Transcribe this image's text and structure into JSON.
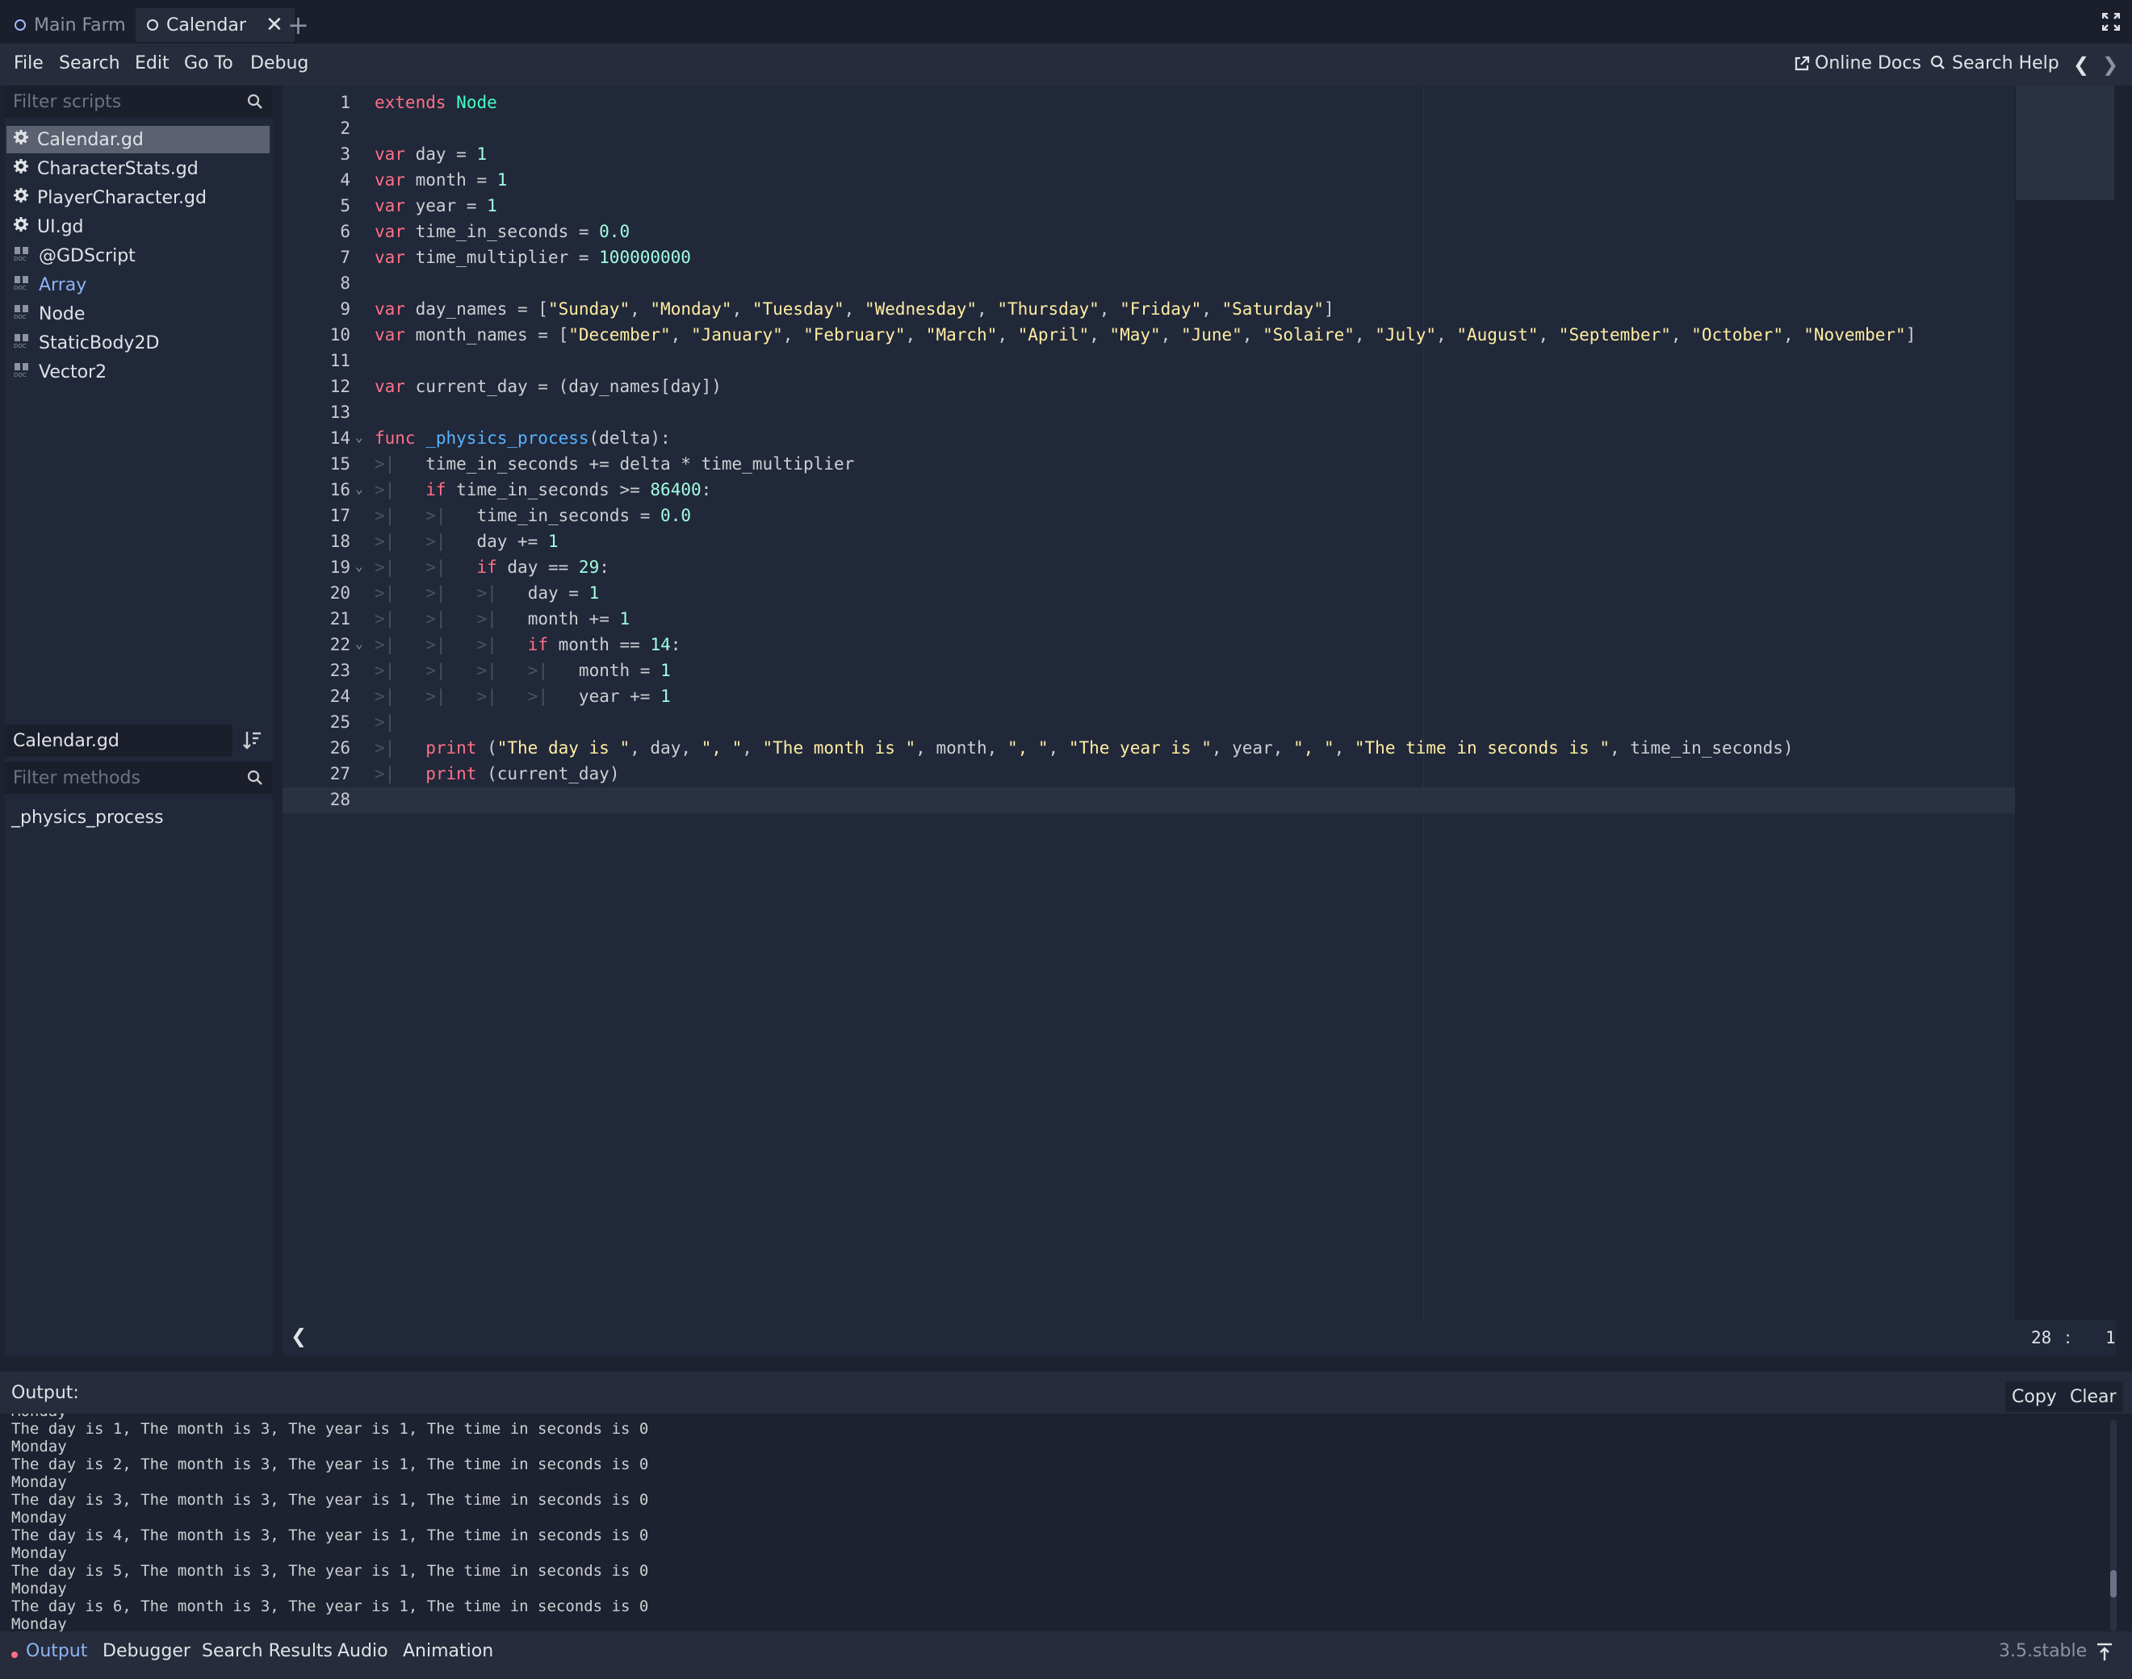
{
  "tabs": [
    {
      "label": "Main Farm",
      "active": false
    },
    {
      "label": "Calendar",
      "active": true
    }
  ],
  "menu": [
    "File",
    "Search",
    "Edit",
    "Go To",
    "Debug"
  ],
  "right_menu": {
    "online_docs": "Online Docs",
    "search_help": "Search Help"
  },
  "scripts_panel": {
    "filter_placeholder": "Filter scripts",
    "items": [
      {
        "label": "Calendar.gd",
        "icon": "gear-icon"
      },
      {
        "label": "CharacterStats.gd",
        "icon": "gear-icon"
      },
      {
        "label": "PlayerCharacter.gd",
        "icon": "gear-icon"
      },
      {
        "label": "UI.gd",
        "icon": "gear-icon"
      },
      {
        "label": "@GDScript",
        "icon": "doc-icon"
      },
      {
        "label": "Array",
        "icon": "doc-icon"
      },
      {
        "label": "Node",
        "icon": "doc-icon"
      },
      {
        "label": "StaticBody2D",
        "icon": "doc-icon"
      },
      {
        "label": "Vector2",
        "icon": "doc-icon"
      }
    ],
    "current_script": "Calendar.gd",
    "filter_methods_placeholder": "Filter methods",
    "methods": [
      "_physics_process"
    ]
  },
  "editor": {
    "cursor_line": "28",
    "cursor_col": "1",
    "lines": [
      {
        "n": "1",
        "html": "<span class=\"kw\">extends</span> <span class=\"ty\">Node</span>"
      },
      {
        "n": "2",
        "html": ""
      },
      {
        "n": "3",
        "html": "<span class=\"kw\">var</span> day = <span class=\"num\">1</span>"
      },
      {
        "n": "4",
        "html": "<span class=\"kw\">var</span> month = <span class=\"num\">1</span>"
      },
      {
        "n": "5",
        "html": "<span class=\"kw\">var</span> year = <span class=\"num\">1</span>"
      },
      {
        "n": "6",
        "html": "<span class=\"kw\">var</span> time_in_seconds = <span class=\"num\">0.0</span>"
      },
      {
        "n": "7",
        "html": "<span class=\"kw\">var</span> time_multiplier = <span class=\"num\">100000000</span>"
      },
      {
        "n": "8",
        "html": ""
      },
      {
        "n": "9",
        "html": "<span class=\"kw\">var</span> day_names = [<span class=\"str\">\"Sunday\"</span>, <span class=\"str\">\"Monday\"</span>, <span class=\"str\">\"Tuesday\"</span>, <span class=\"str\">\"Wednesday\"</span>, <span class=\"str\">\"Thursday\"</span>, <span class=\"str\">\"Friday\"</span>, <span class=\"str\">\"Saturday\"</span>]"
      },
      {
        "n": "10",
        "html": "<span class=\"kw\">var</span> month_names = [<span class=\"str\">\"December\"</span>, <span class=\"str\">\"January\"</span>, <span class=\"str\">\"February\"</span>, <span class=\"str\">\"March\"</span>, <span class=\"str\">\"April\"</span>, <span class=\"str\">\"May\"</span>, <span class=\"str\">\"June\"</span>, <span class=\"str\">\"Solaire\"</span>, <span class=\"str\">\"July\"</span>, <span class=\"str\">\"August\"</span>, <span class=\"str\">\"September\"</span>, <span class=\"str\">\"October\"</span>, <span class=\"str\">\"November\"</span>]"
      },
      {
        "n": "11",
        "html": ""
      },
      {
        "n": "12",
        "html": "<span class=\"kw\">var</span> current_day = (day_names[day])"
      },
      {
        "n": "13",
        "html": ""
      },
      {
        "n": "14",
        "html": "<span class=\"kw\">func</span> <span class=\"fn\">_physics_process</span>(delta):",
        "fold": true
      },
      {
        "n": "15",
        "html": "<span class=\"tab\">&gt;|</span>   time_in_seconds += delta * time_multiplier"
      },
      {
        "n": "16",
        "html": "<span class=\"tab\">&gt;|</span>   <span class=\"kw\">if</span> time_in_seconds &gt;= <span class=\"num\">86400</span>:",
        "fold": true
      },
      {
        "n": "17",
        "html": "<span class=\"tab\">&gt;|</span>   <span class=\"tab\">&gt;|</span>   time_in_seconds = <span class=\"num\">0.0</span>"
      },
      {
        "n": "18",
        "html": "<span class=\"tab\">&gt;|</span>   <span class=\"tab\">&gt;|</span>   day += <span class=\"num\">1</span>"
      },
      {
        "n": "19",
        "html": "<span class=\"tab\">&gt;|</span>   <span class=\"tab\">&gt;|</span>   <span class=\"kw\">if</span> day == <span class=\"num\">29</span>:",
        "fold": true
      },
      {
        "n": "20",
        "html": "<span class=\"tab\">&gt;|</span>   <span class=\"tab\">&gt;|</span>   <span class=\"tab\">&gt;|</span>   day = <span class=\"num\">1</span>"
      },
      {
        "n": "21",
        "html": "<span class=\"tab\">&gt;|</span>   <span class=\"tab\">&gt;|</span>   <span class=\"tab\">&gt;|</span>   month += <span class=\"num\">1</span>"
      },
      {
        "n": "22",
        "html": "<span class=\"tab\">&gt;|</span>   <span class=\"tab\">&gt;|</span>   <span class=\"tab\">&gt;|</span>   <span class=\"kw\">if</span> month == <span class=\"num\">14</span>:",
        "fold": true
      },
      {
        "n": "23",
        "html": "<span class=\"tab\">&gt;|</span>   <span class=\"tab\">&gt;|</span>   <span class=\"tab\">&gt;|</span>   <span class=\"tab\">&gt;|</span>   month = <span class=\"num\">1</span>"
      },
      {
        "n": "24",
        "html": "<span class=\"tab\">&gt;|</span>   <span class=\"tab\">&gt;|</span>   <span class=\"tab\">&gt;|</span>   <span class=\"tab\">&gt;|</span>   year += <span class=\"num\">1</span>"
      },
      {
        "n": "25",
        "html": "<span class=\"tab\">&gt;|</span>"
      },
      {
        "n": "26",
        "html": "<span class=\"tab\">&gt;|</span>   <span class=\"kw\">print</span> (<span class=\"str\">\"The day is \"</span>, day, <span class=\"str\">\", \"</span>, <span class=\"str\">\"The month is \"</span>, month, <span class=\"str\">\", \"</span>, <span class=\"str\">\"The year is \"</span>, year, <span class=\"str\">\", \"</span>, <span class=\"str\">\"The time in seconds is \"</span>, time_in_seconds)"
      },
      {
        "n": "27",
        "html": "<span class=\"tab\">&gt;|</span>   <span class=\"kw\">print</span> (current_day)"
      },
      {
        "n": "28",
        "html": "",
        "current": true
      }
    ]
  },
  "output": {
    "label": "Output:",
    "copy": "Copy",
    "clear": "Clear",
    "lines": [
      "Monday",
      "The day is 1, The month is 3, The year is 1, The time in seconds is 0",
      "Monday",
      "The day is 2, The month is 3, The year is 1, The time in seconds is 0",
      "Monday",
      "The day is 3, The month is 3, The year is 1, The time in seconds is 0",
      "Monday",
      "The day is 4, The month is 3, The year is 1, The time in seconds is 0",
      "Monday",
      "The day is 5, The month is 3, The year is 1, The time in seconds is 0",
      "Monday",
      "The day is 6, The month is 3, The year is 1, The time in seconds is 0",
      "Monday"
    ]
  },
  "bottom_tabs": [
    "Output",
    "Debugger",
    "Search Results",
    "Audio",
    "Animation"
  ],
  "version": "3.5.stable",
  "colors": {
    "accent": "#8db3f5",
    "keyword": "#ff7085",
    "string": "#ffeda1",
    "number": "#a1ffe0",
    "type": "#42ffc2"
  }
}
